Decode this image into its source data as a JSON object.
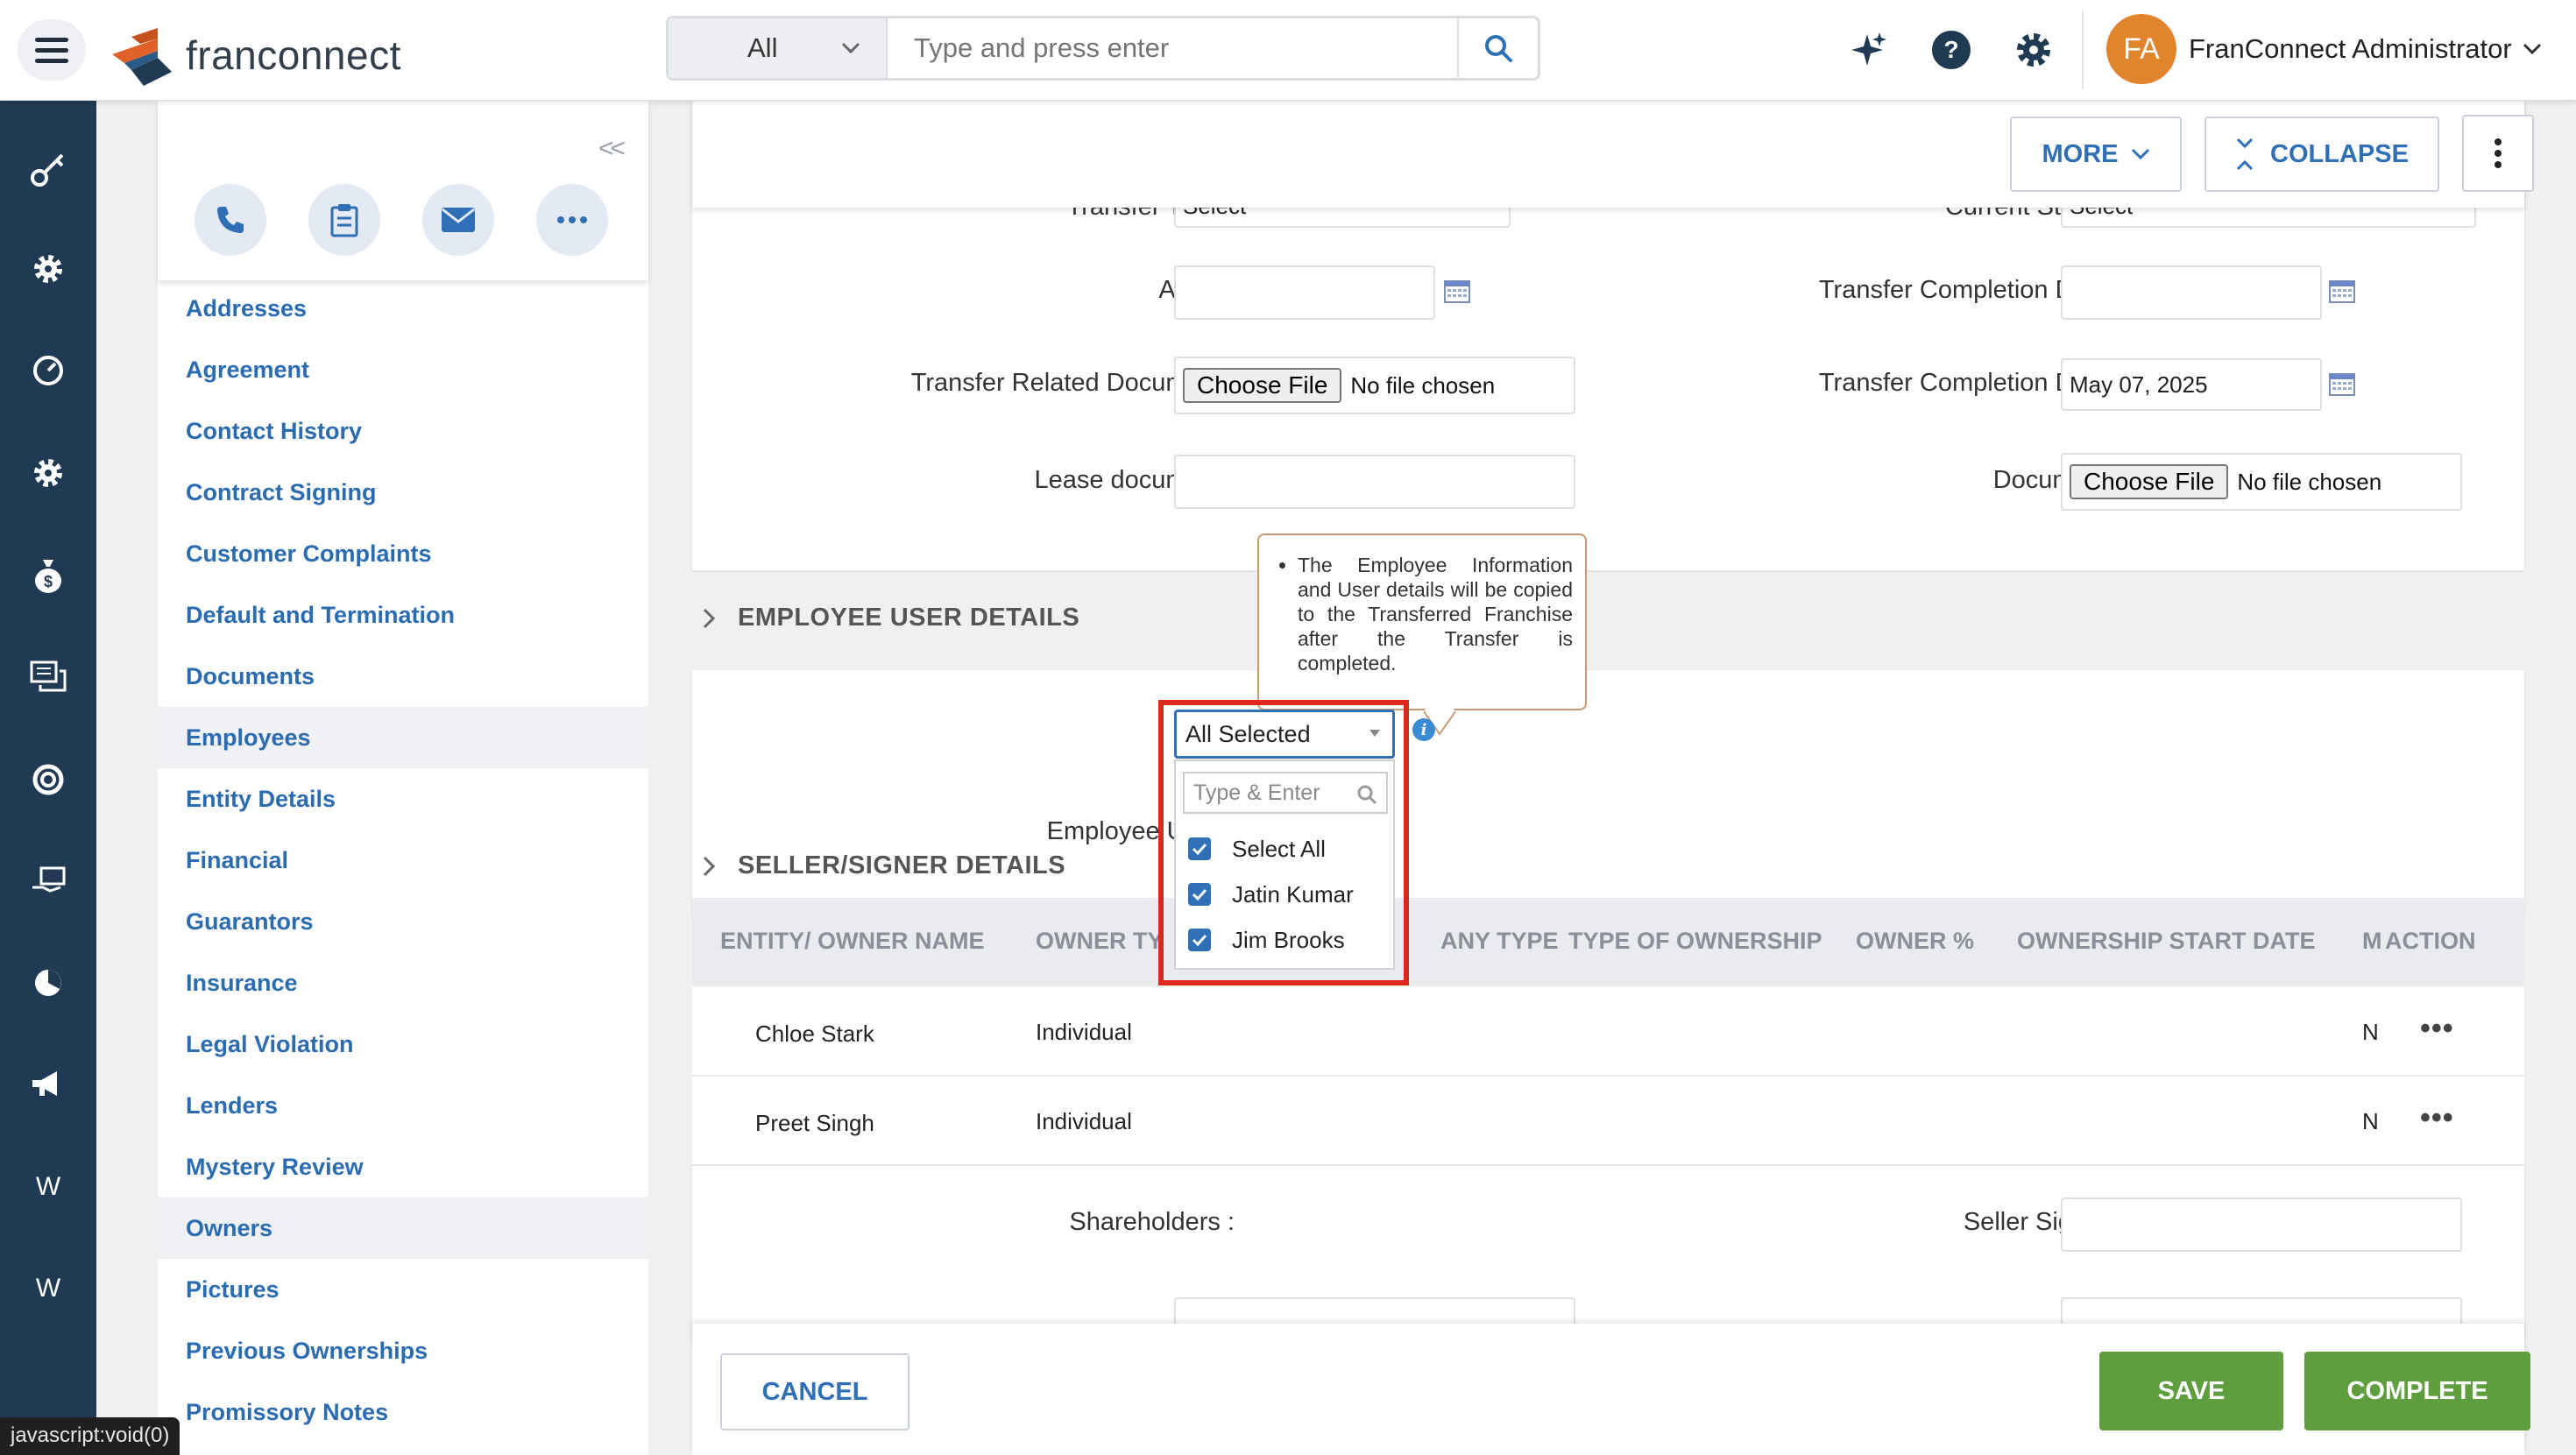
{
  "header": {
    "logo_text": "franconnect",
    "search_scope": "All",
    "search_placeholder": "Type and press enter",
    "avatar_initials": "FA",
    "user_name": "FranConnect Administrator"
  },
  "rail": {
    "items": [
      "key-icon",
      "gear-icon",
      "speedometer-icon",
      "gear-icon",
      "money-bag-icon",
      "chat-icon",
      "support-icon",
      "hand-money-icon",
      "pie-icon",
      "megaphone-icon",
      "W",
      "W"
    ]
  },
  "sidebar": {
    "collapse_glyph": "<<",
    "items": [
      {
        "label": "Addresses",
        "active": false
      },
      {
        "label": "Agreement",
        "active": false
      },
      {
        "label": "Contact History",
        "active": false
      },
      {
        "label": "Contract Signing",
        "active": false
      },
      {
        "label": "Customer Complaints",
        "active": false
      },
      {
        "label": "Default and Termination",
        "active": false
      },
      {
        "label": "Documents",
        "active": false
      },
      {
        "label": "Employees",
        "active": true
      },
      {
        "label": "Entity Details",
        "active": false
      },
      {
        "label": "Financial",
        "active": false
      },
      {
        "label": "Guarantors",
        "active": false
      },
      {
        "label": "Insurance",
        "active": false
      },
      {
        "label": "Legal Violation",
        "active": false
      },
      {
        "label": "Lenders",
        "active": false
      },
      {
        "label": "Mystery Review",
        "active": false
      },
      {
        "label": "Owners",
        "active": true
      },
      {
        "label": "Pictures",
        "active": false
      },
      {
        "label": "Previous Ownerships",
        "active": false
      },
      {
        "label": "Promissory Notes",
        "active": false
      }
    ]
  },
  "toolbar": {
    "more_label": "MORE",
    "collapse_label": "COLLAPSE"
  },
  "form": {
    "transfer_type_label": "Transfer Type :",
    "transfer_type_value": "Select",
    "current_status_label": "Current Status :",
    "current_status_value": "Select",
    "as_of_label": "As Of :",
    "as_of_value": "",
    "transfer_completion_date_label_1": "Transfer Completion Date :",
    "transfer_completion_date_value_1": "",
    "transfer_related_document_label": "Transfer Related Document :",
    "choose_file_label": "Choose File",
    "no_file_text": "No file chosen",
    "transfer_completion_date_label_2": "Transfer Completion Date :",
    "transfer_completion_date_value_2": "May 07, 2025",
    "lease_document_label": "Lease document :",
    "lease_document_value": "",
    "document_label": "Document :"
  },
  "employee_section": {
    "title": "EMPLOYEE USER DETAILS",
    "tooltip": "The Employee Information and User details will be copied to the Transferred Franchise after the Transfer is completed.",
    "employee_user_label": "Employee User :",
    "selected_value": "All Selected",
    "search_placeholder": "Type & Enter",
    "options": [
      {
        "label": "Select All",
        "checked": true
      },
      {
        "label": "Jatin Kumar",
        "checked": true
      },
      {
        "label": "Jim Brooks",
        "checked": true
      }
    ]
  },
  "seller_section": {
    "title": "SELLER/SIGNER DETAILS",
    "columns": [
      "ENTITY/ OWNER NAME",
      "OWNER TY",
      "ANY TYPE",
      "TYPE OF OWNERSHIP",
      "OWNER %",
      "OWNERSHIP START DATE",
      "M",
      "ACTION"
    ],
    "rows": [
      {
        "name": "Chloe Stark",
        "owner_type": "Individual",
        "trunc": "N"
      },
      {
        "name": "Preet Singh",
        "owner_type": "Individual",
        "trunc": "N"
      }
    ],
    "shareholders_label": "Shareholders :",
    "seller_signer_label": "Seller Signer :"
  },
  "footer": {
    "cancel_label": "CANCEL",
    "save_label": "SAVE",
    "complete_label": "COMPLETE"
  },
  "status_bar": "javascript:void(0)",
  "colors": {
    "rail_bg": "#1f3a52",
    "link_blue": "#2b6cb0",
    "accent_blue": "#2f6fb6",
    "save_green": "#5e9e3e",
    "highlight_red": "#e0251b",
    "avatar_orange": "#e0852b"
  }
}
